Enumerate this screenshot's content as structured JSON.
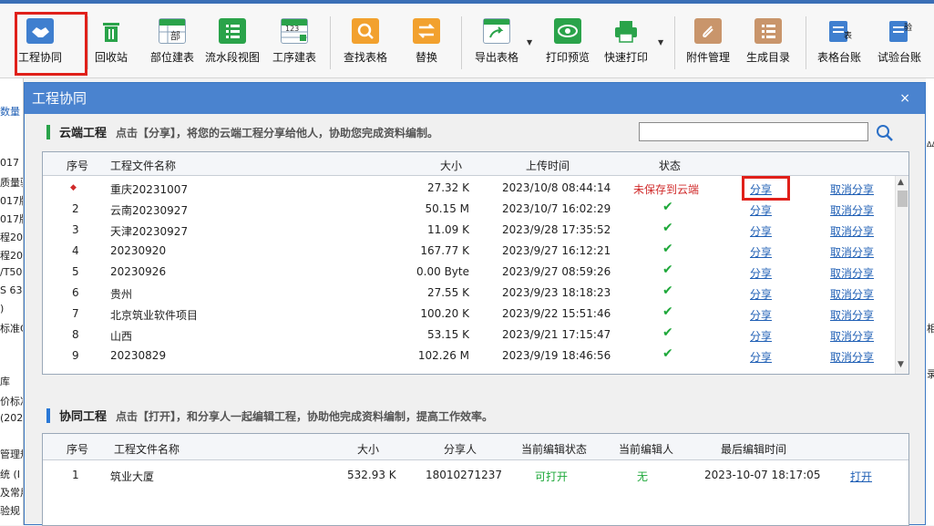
{
  "toolbar": {
    "items": [
      {
        "label": "工程协同",
        "icon": "handshake-icon"
      },
      {
        "label": "回收站",
        "icon": "recycle-bin-icon"
      },
      {
        "label": "部位建表",
        "icon": "part-table-icon"
      },
      {
        "label": "流水段视图",
        "icon": "flow-view-icon"
      },
      {
        "label": "工序建表",
        "icon": "process-table-icon"
      },
      {
        "label": "查找表格",
        "icon": "search-table-icon"
      },
      {
        "label": "替换",
        "icon": "replace-icon"
      },
      {
        "label": "导出表格",
        "icon": "export-icon"
      },
      {
        "label": "打印预览",
        "icon": "eye-icon"
      },
      {
        "label": "快速打印",
        "icon": "printer-icon"
      },
      {
        "label": "附件管理",
        "icon": "paperclip-icon"
      },
      {
        "label": "生成目录",
        "icon": "catalog-icon"
      },
      {
        "label": "表格台账",
        "icon": "table-ledger-icon"
      },
      {
        "label": "试验台账",
        "icon": "test-ledger-icon"
      }
    ],
    "part_icon_text": "部",
    "process_icon_text": "123",
    "ledger_icon_text": "表",
    "test_icon_text": "验"
  },
  "background": {
    "left_texts": [
      "数量",
      "017",
      "质量验",
      "017版",
      "017版",
      "程202",
      "程202",
      "/T50",
      "S 63",
      ")",
      "标准G",
      "库",
      "价标准",
      "(202",
      "管理规",
      "统 (I",
      "及常用",
      "验规"
    ],
    "right_texts": [
      "ΔΔ",
      "相",
      "录"
    ]
  },
  "dialog": {
    "title": "工程协同",
    "close": "×",
    "cloud": {
      "heading": "云端工程",
      "hint": "点击【分享】，将您的云端工程分享给他人，协助您完成资料编制。",
      "columns": [
        "序号",
        "工程文件名称",
        "大小",
        "上传时间",
        "状态"
      ],
      "rows": [
        {
          "no": "◆",
          "name": "重庆20231007",
          "size": "27.32 K",
          "time": "2023/10/8 08:44:14",
          "status": "未保存到云端",
          "share": "分享",
          "cancel": "取消分享"
        },
        {
          "no": "2",
          "name": "云南20230927",
          "size": "50.15 M",
          "time": "2023/10/7 16:02:29",
          "status": "✔",
          "share": "分享",
          "cancel": "取消分享"
        },
        {
          "no": "3",
          "name": "天津20230927",
          "size": "11.09 K",
          "time": "2023/9/28 17:35:52",
          "status": "✔",
          "share": "分享",
          "cancel": "取消分享"
        },
        {
          "no": "4",
          "name": "20230920",
          "size": "167.77 K",
          "time": "2023/9/27 16:12:21",
          "status": "✔",
          "share": "分享",
          "cancel": "取消分享"
        },
        {
          "no": "5",
          "name": "20230926",
          "size": "0.00 Byte",
          "time": "2023/9/27 08:59:26",
          "status": "✔",
          "share": "分享",
          "cancel": "取消分享"
        },
        {
          "no": "6",
          "name": "贵州",
          "size": "27.55 K",
          "time": "2023/9/23 18:18:23",
          "status": "✔",
          "share": "分享",
          "cancel": "取消分享"
        },
        {
          "no": "7",
          "name": "北京筑业软件项目",
          "size": "100.20 K",
          "time": "2023/9/22 15:51:46",
          "status": "✔",
          "share": "分享",
          "cancel": "取消分享"
        },
        {
          "no": "8",
          "name": "山西",
          "size": "53.15 K",
          "time": "2023/9/21 17:15:47",
          "status": "✔",
          "share": "分享",
          "cancel": "取消分享"
        },
        {
          "no": "9",
          "name": "20230829",
          "size": "102.26 M",
          "time": "2023/9/19 18:46:56",
          "status": "✔",
          "share": "分享",
          "cancel": "取消分享"
        }
      ]
    },
    "collab": {
      "heading": "协同工程",
      "hint": "点击【打开】，和分享人一起编辑工程，协助他完成资料编制，提高工作效率。",
      "columns": [
        "序号",
        "工程文件名称",
        "大小",
        "分享人",
        "当前编辑状态",
        "当前编辑人",
        "最后编辑时间"
      ],
      "rows": [
        {
          "no": "1",
          "name": "筑业大厦",
          "size": "532.93 K",
          "sharer": "18010271237",
          "state": "可打开",
          "editor": "无",
          "time": "2023-10-07 18:17:05",
          "open": "打开"
        }
      ]
    }
  },
  "colors": {
    "accent": "#4a83cf",
    "highlight": "#e0201a",
    "ok": "#1ea83a",
    "link": "#1f5fb5"
  }
}
